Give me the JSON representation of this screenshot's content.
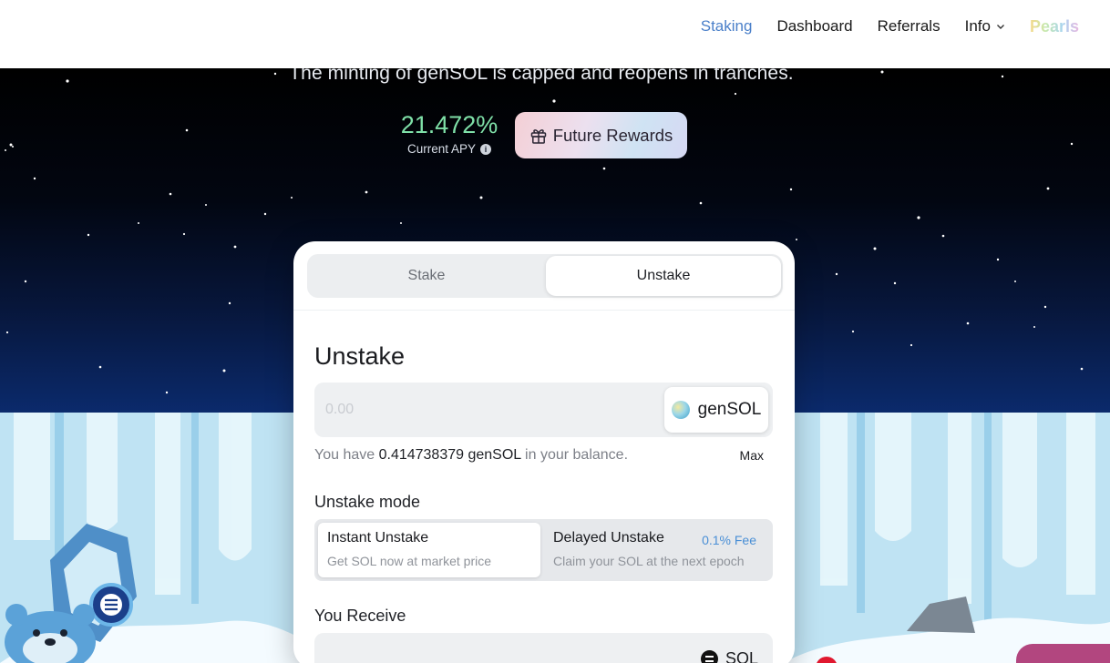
{
  "nav": {
    "items": [
      {
        "label": "Staking",
        "active": true
      },
      {
        "label": "Dashboard",
        "active": false
      },
      {
        "label": "Referrals",
        "active": false
      },
      {
        "label": "Info",
        "active": false,
        "has_dropdown": true
      }
    ],
    "brand": "Pearls"
  },
  "hero": {
    "tagline": "The minting of genSOL is capped and reopens in tranches.",
    "apy_value": "21.472%",
    "apy_label": "Current APY",
    "rewards_button": "Future Rewards"
  },
  "card": {
    "tabs": [
      {
        "label": "Stake",
        "selected": false
      },
      {
        "label": "Unstake",
        "selected": true
      }
    ],
    "title": "Unstake",
    "amount": {
      "placeholder": "0.00",
      "value": "",
      "token": "genSOL"
    },
    "balance": {
      "prefix": "You have",
      "amount": "0.414738379 genSOL",
      "suffix": "in your balance."
    },
    "max_label": "Max",
    "mode_label": "Unstake mode",
    "modes": [
      {
        "title": "Instant Unstake",
        "subtitle": "Get SOL now at market price",
        "selected": true
      },
      {
        "title": "Delayed Unstake",
        "subtitle": "Claim your SOL at the next epoch",
        "fee": "0.1% Fee",
        "selected": false
      }
    ],
    "receive_label": "You Receive",
    "receive_token": "SOL"
  },
  "icons": {
    "info_icon": "info-icon",
    "gift_icon": "gift-icon",
    "chevron_icon": "chevron-down-icon",
    "gensol_icon": "gensol-token-icon",
    "sol_icon": "sol-token-icon"
  },
  "colors": {
    "nav_active": "#4a7fc9",
    "apy_green": "#7fe0a8",
    "fee_blue": "#4a8fd6",
    "accent_pink": "#b2467f"
  }
}
